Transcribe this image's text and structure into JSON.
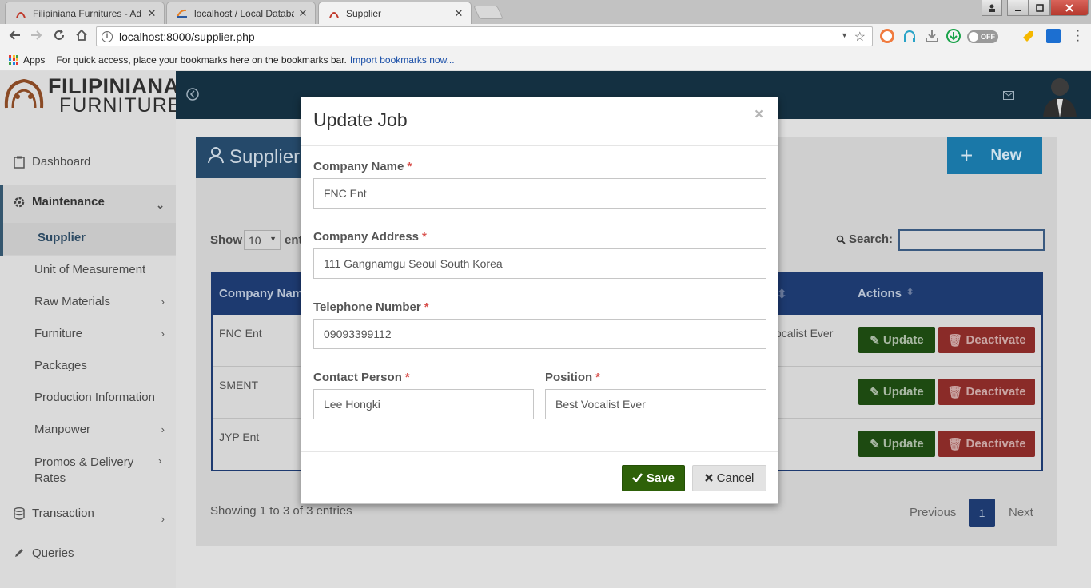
{
  "browser": {
    "tabs": [
      {
        "label": "Filipiniana Furnitures - Ad",
        "close": "✕"
      },
      {
        "label": "localhost / Local Databas",
        "close": "✕"
      },
      {
        "label": "Supplier",
        "close": "✕"
      }
    ],
    "ghost_tab_title": "",
    "url": "localhost:8000/supplier.php",
    "bookmarks": {
      "apps_label": "Apps",
      "hint": "For quick access, place your bookmarks here on the bookmarks bar.",
      "import_link": "Import bookmarks now..."
    },
    "off_switch_label": "OFF"
  },
  "app": {
    "logo": {
      "name": "FILIPINIANA",
      "sub": "FURNITURE"
    },
    "sidebar": {
      "dashboard": "Dashboard",
      "maintenance": "Maintenance",
      "items": [
        "Supplier",
        "Unit of Measurement",
        "Raw Materials",
        "Furniture",
        "Packages",
        "Production Information",
        "Manpower",
        "Promos & Delivery Rates"
      ],
      "transaction": "Transaction",
      "queries": "Queries"
    },
    "page_title": "Supplier",
    "new_button": "New",
    "show_label": "Show",
    "show_value": "10",
    "entries_label": "ent",
    "search_label": "Search:",
    "table": {
      "col_company": "Company Nam",
      "col_actions": "Actions",
      "rows": [
        {
          "company": "FNC Ent",
          "position": "ocalist Ever"
        },
        {
          "company": "SMENT",
          "position": ""
        },
        {
          "company": "JYP Ent",
          "position": ""
        }
      ],
      "update_label": "Update",
      "deactivate_label": "Deactivate"
    },
    "showing_text": "Showing 1 to 3 of 3 entries",
    "pagination": {
      "previous": "Previous",
      "page": "1",
      "next": "Next"
    }
  },
  "modal": {
    "title": "Update Job",
    "close": "×",
    "company_name_label": "Company Name",
    "company_name_value": "FNC Ent",
    "company_address_label": "Company Address",
    "company_address_value": "111 Gangnamgu Seoul South Korea",
    "telephone_label": "Telephone Number",
    "telephone_value": "09093399112",
    "contact_label": "Contact Person",
    "contact_value": "Lee Hongki",
    "position_label": "Position",
    "position_value": "Best Vocalist Ever",
    "required_marker": "*",
    "save_label": "Save",
    "cancel_label": "Cancel"
  },
  "colors": {
    "topbar": "#143041",
    "table_header": "#1d3a70",
    "save_green": "#2e6109",
    "deactivate_red": "#8a2b28",
    "new_blue": "#1a78a8",
    "required_red": "#d9534f"
  }
}
